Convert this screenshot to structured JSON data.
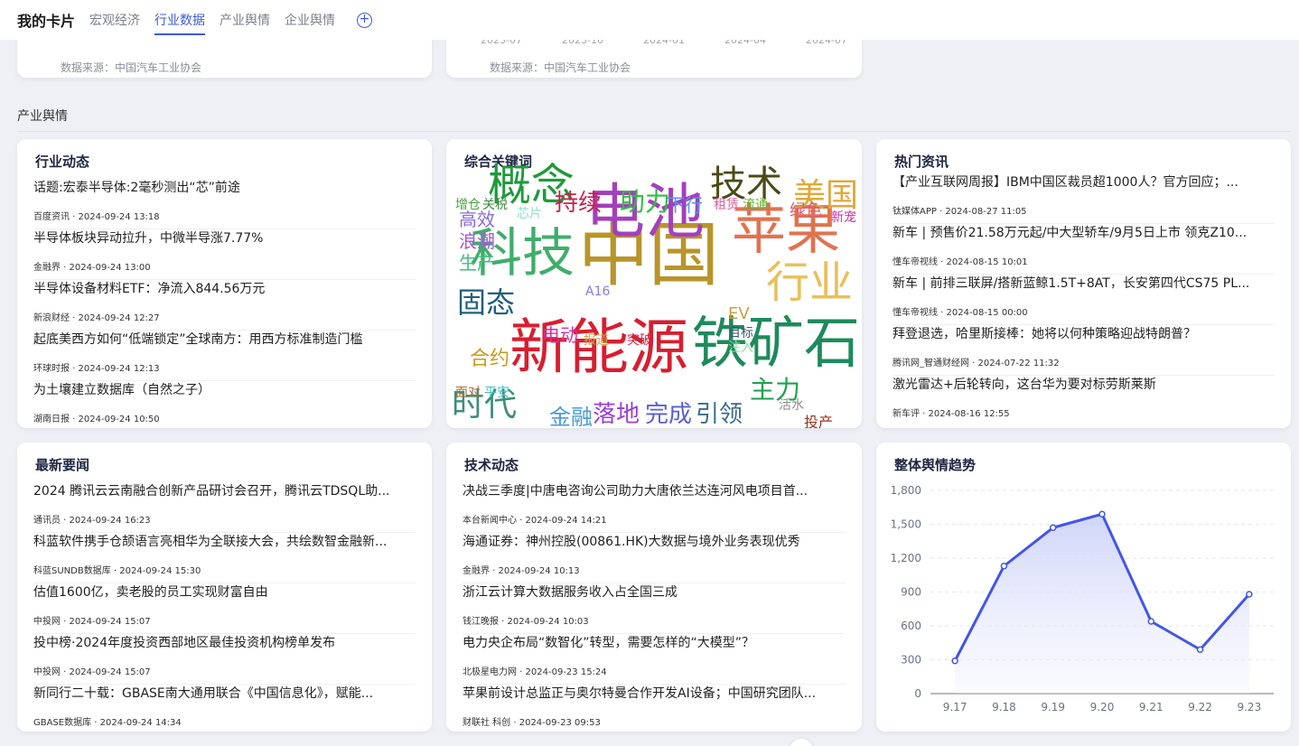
{
  "header": {
    "title": "我的卡片",
    "tabs": [
      {
        "label": "宏观经济",
        "active": false
      },
      {
        "label": "行业数据",
        "active": true
      },
      {
        "label": "产业舆情",
        "active": false
      },
      {
        "label": "企业舆情",
        "active": false
      }
    ],
    "add_label": "+"
  },
  "top_cards": [
    {
      "ticks": [],
      "source": "数据来源：中国汽车工业协会"
    },
    {
      "ticks": [
        "2023-07",
        "2023-10",
        "2024-01",
        "2024-04",
        "2024-07"
      ],
      "source": "数据来源：中国汽车工业协会"
    }
  ],
  "section": {
    "title": "产业舆情"
  },
  "cards": {
    "industry_news": {
      "title": "行业动态",
      "items": [
        {
          "title": "话题:宏泰半导体:2毫秒测出“芯”前途",
          "meta": "百度资讯 · 2024-09-24 13:18"
        },
        {
          "title": "半导体板块异动拉升，中微半导涨7.77%",
          "meta": "金融界 · 2024-09-24 13:00"
        },
        {
          "title": "半导体设备材料ETF：净流入844.56万元",
          "meta": "新浪财经 · 2024-09-24 12:27"
        },
        {
          "title": "起底美西方如何“低端锁定”全球南方：用西方标准制造门槛",
          "meta": "环球时报 · 2024-09-24 12:13"
        },
        {
          "title": "为土壤建立数据库（自然之子）",
          "meta": "湖南日报 · 2024-09-24 10:50"
        }
      ]
    },
    "keywords": {
      "title": "综合关键词",
      "words": [
        {
          "text": "中国",
          "color": "#b8942a"
        },
        {
          "text": "电池",
          "color": "#a43fbd"
        },
        {
          "text": "新能源",
          "color": "#d81e2f"
        },
        {
          "text": "铁矿石",
          "color": "#1f8a5c"
        },
        {
          "text": "科技",
          "color": "#3fae6a"
        },
        {
          "text": "苹果",
          "color": "#e0734f"
        },
        {
          "text": "概念",
          "color": "#1f9a3c"
        },
        {
          "text": "技术",
          "color": "#4a4a16"
        },
        {
          "text": "行业",
          "color": "#e8c05a"
        },
        {
          "text": "时代",
          "color": "#3d8f7a"
        },
        {
          "text": "美国",
          "color": "#e0a83a"
        },
        {
          "text": "固态",
          "color": "#1f5f7a"
        },
        {
          "text": "持续",
          "color": "#c8204a"
        },
        {
          "text": "助力",
          "color": "#2fbf3f"
        },
        {
          "text": "主力",
          "color": "#1fa04f"
        },
        {
          "text": "落地",
          "color": "#9a3fd8"
        },
        {
          "text": "完成",
          "color": "#5a5fd0"
        },
        {
          "text": "引领",
          "color": "#3a6a8a"
        },
        {
          "text": "金融",
          "color": "#4a9ad8"
        },
        {
          "text": "合约",
          "color": "#c89a1a"
        },
        {
          "text": "生产",
          "color": "#3fbf7f"
        },
        {
          "text": "浪潮",
          "color": "#a05ad8"
        },
        {
          "text": "高效",
          "color": "#8a6ad8"
        },
        {
          "text": "电动",
          "color": "#d030a0"
        },
        {
          "text": "绿色",
          "color": "#e06070"
        },
        {
          "text": "下行",
          "color": "#4a9ae8"
        },
        {
          "text": "EV",
          "color": "#c8a040"
        },
        {
          "text": "投产",
          "color": "#9a3020"
        },
        {
          "text": "租赁",
          "color": "#e060a0"
        },
        {
          "text": "流通",
          "color": "#6ab030"
        },
        {
          "text": "增仓",
          "color": "#4aa040"
        },
        {
          "text": "关税",
          "color": "#3a8a3a"
        },
        {
          "text": "芯片",
          "color": "#8ae0d0"
        },
        {
          "text": "A16",
          "color": "#8a7ae8"
        },
        {
          "text": "报道",
          "color": "#d0a040"
        },
        {
          "text": "突破",
          "color": "#d02040"
        },
        {
          "text": "目标",
          "color": "#3a5a7a"
        },
        {
          "text": "注入",
          "color": "#8ae0a0"
        },
        {
          "text": "面对",
          "color": "#a0703a"
        },
        {
          "text": "平安",
          "color": "#3ac0c0"
        },
        {
          "text": "活水",
          "color": "#8a8a8a"
        },
        {
          "text": "能源",
          "color": "#c0e060"
        },
        {
          "text": "新宠",
          "color": "#d030a0"
        }
      ]
    },
    "hot_news": {
      "title": "热门资讯",
      "items": [
        {
          "title": "【产业互联网周报】IBM中国区裁员超1000人？官方回应；...",
          "meta": "钛媒体APP · 2024-08-27 11:05"
        },
        {
          "title": "新车 | 预售价21.58万元起/中大型轿车/9月5日上市 领克Z10...",
          "meta": "懂车帝视线 · 2024-08-15 10:01"
        },
        {
          "title": "新车 | 前排三联屏/搭新蓝鲸1.5T+8AT，长安第四代CS75 PL...",
          "meta": "懂车帝视线 · 2024-08-15 00:00"
        },
        {
          "title": "拜登退选，哈里斯接棒：她将以何种策略迎战特朗普？",
          "meta": "腾讯网_智通财经网 · 2024-07-22 11:32"
        },
        {
          "title": "激光雷达+后轮转向，这台华为要对标劳斯莱斯",
          "meta": "新车评 · 2024-08-16 12:55"
        }
      ]
    },
    "latest_news": {
      "title": "最新要闻",
      "items": [
        {
          "title": "2024 腾讯云云南融合创新产品研讨会召开，腾讯云TDSQL助...",
          "meta": "通讯员 · 2024-09-24 16:23"
        },
        {
          "title": "科蓝软件携手仓颉语言亮相华为全联接大会，共绘数智金融新...",
          "meta": "科蓝SUNDB数据库 · 2024-09-24 15:30"
        },
        {
          "title": "估值1600亿，卖老股的员工实现财富自由",
          "meta": "中投网 · 2024-09-24 15:07"
        },
        {
          "title": "投中榜·2024年度投资西部地区最佳投资机构榜单发布",
          "meta": "中投网 · 2024-09-24 15:07"
        },
        {
          "title": "新同行二十载：GBASE南大通用联合《中国信息化》，赋能...",
          "meta": "GBASE数据库 · 2024-09-24 14:34"
        }
      ]
    },
    "tech_news": {
      "title": "技术动态",
      "items": [
        {
          "title": "决战三季度|中唐电咨询公司助力大唐依兰达连河风电项目首...",
          "meta": "本台新闻中心 · 2024-09-24 14:21"
        },
        {
          "title": "海通证券：神州控股(00861.HK)大数据与境外业务表现优秀",
          "meta": "金融界 · 2024-09-24 10:13"
        },
        {
          "title": "浙江云计算大数据服务收入占全国三成",
          "meta": "钱江晚报 · 2024-09-24 10:03"
        },
        {
          "title": "电力央企布局“数智化”转型，需要怎样的“大模型”？",
          "meta": "北极星电力网 · 2024-09-23 15:24"
        },
        {
          "title": "苹果前设计总监正与奥尔特曼合作开发AI设备；中国研究团队...",
          "meta": "财联社  科创 · 2024-09-23 09:53"
        }
      ]
    },
    "trend": {
      "title": "整体舆情趋势"
    }
  },
  "chart_data": {
    "type": "area",
    "title": "整体舆情趋势",
    "categories": [
      "9.17",
      "9.18",
      "9.19",
      "9.20",
      "9.21",
      "9.22",
      "9.23"
    ],
    "values": [
      290,
      1130,
      1470,
      1590,
      640,
      390,
      880
    ],
    "ylim": [
      0,
      1800
    ],
    "yticks": [
      "0",
      "300",
      "600",
      "900",
      "1,200",
      "1,500",
      "1,800"
    ],
    "color": "#4355e8",
    "grid": true
  }
}
